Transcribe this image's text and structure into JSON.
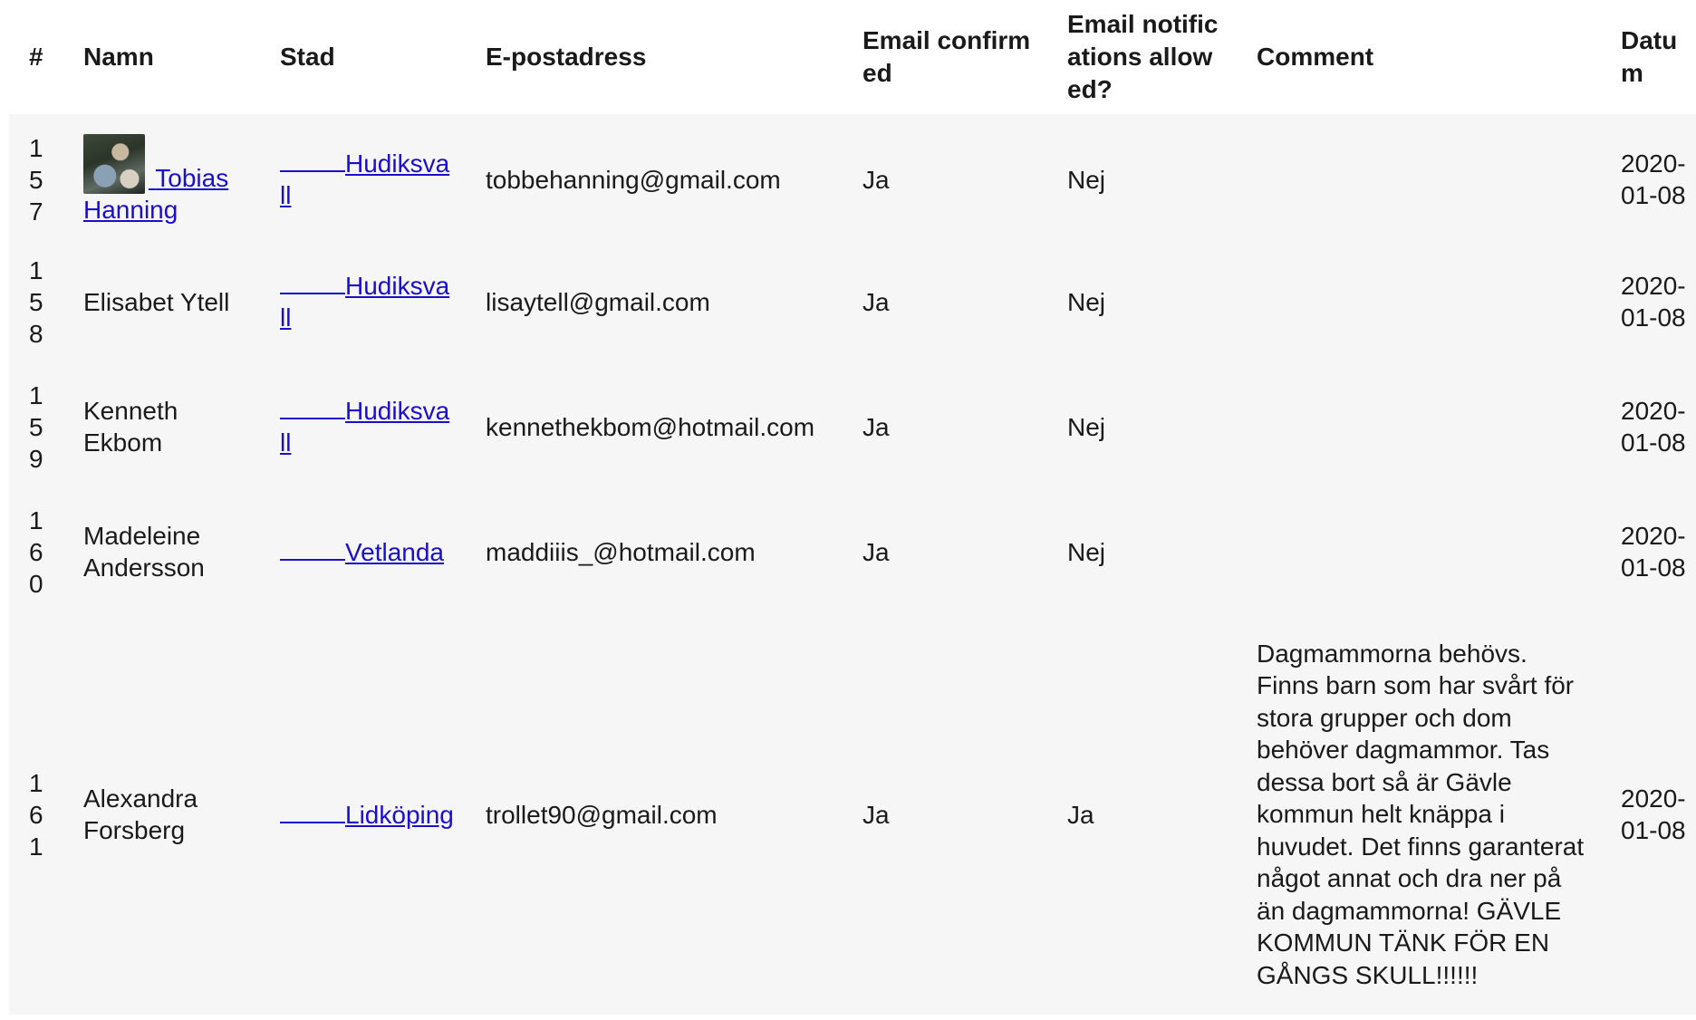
{
  "table": {
    "headers": {
      "num": "#",
      "name": "Namn",
      "city": "Stad",
      "email": "E-postadress",
      "confirmed": "Email confirmed",
      "notifications": "Email notifications allowed?",
      "comment": "Comment",
      "date": "Datum"
    },
    "rows": [
      {
        "num": "157",
        "name": "Tobias Hanning",
        "name_is_link": true,
        "has_avatar": true,
        "city": "Hudiksvall",
        "email": "tobbehanning@gmail.com",
        "confirmed": "Ja",
        "notifications": "Nej",
        "comment": "",
        "date": "2020-01-08"
      },
      {
        "num": "158",
        "name": "Elisabet Ytell",
        "city": "Hudiksvall ",
        "email": "lisaytell@gmail.com",
        "confirmed": "Ja",
        "notifications": "Nej",
        "comment": "",
        "date": "2020-01-08"
      },
      {
        "num": "159",
        "name": "Kenneth Ekbom",
        "city": "Hudiksvall ",
        "email": "kennethekbom@hotmail.com",
        "confirmed": "Ja",
        "notifications": "Nej",
        "comment": "",
        "date": "2020-01-08"
      },
      {
        "num": "160",
        "name": "Madeleine Andersson",
        "city": "Vetlanda",
        "email": "maddiiis_@hotmail.com",
        "confirmed": "Ja",
        "notifications": "Nej",
        "comment": "",
        "date": "2020-01-08"
      },
      {
        "num": "161",
        "name": "Alexandra Forsberg",
        "city": "Lidköping ",
        "email": "trollet90@gmail.com",
        "confirmed": "Ja",
        "notifications": "Ja",
        "comment": "Dagmammorna behövs. Finns barn som har svårt för stora grupper och dom behöver dagmammor. Tas dessa bort så är Gävle kommun helt knäppa i huvudet. Det finns garanterat något annat och dra ner på än dagmammorna! GÄVLE KOMMUN TÄNK FÖR EN GÅNGS SKULL!!!!!!",
        "date": "2020-01-08"
      }
    ]
  },
  "colors": {
    "link": "#1a0dcc",
    "row_background": "#f6f6f6",
    "header_background": "#ffffff"
  }
}
